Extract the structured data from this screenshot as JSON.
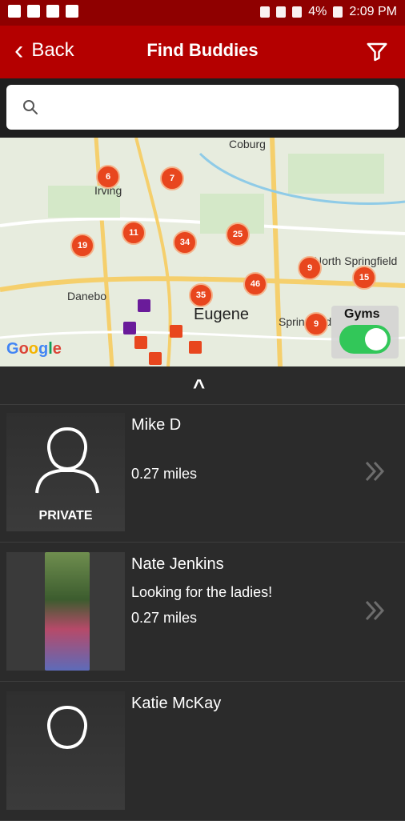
{
  "status": {
    "time": "2:09 PM",
    "battery_text": "4%"
  },
  "header": {
    "back_label": "Back",
    "title": "Find Buddies"
  },
  "search": {
    "placeholder": ""
  },
  "map": {
    "labels": [
      "Coburg",
      "Irving",
      "Danebo",
      "Eugene",
      "Springfield",
      "North Springfield"
    ],
    "clusters": [
      "6",
      "7",
      "19",
      "11",
      "34",
      "25",
      "35",
      "46",
      "9",
      "15",
      "9"
    ],
    "google_logo": "Google",
    "gyms_label": "Gyms",
    "gyms_enabled": true
  },
  "list": {
    "rows": [
      {
        "name": "Mike D",
        "tagline": "",
        "distance": "0.27 miles",
        "private": true,
        "private_label": "PRIVATE"
      },
      {
        "name": "Nate Jenkins",
        "tagline": "Looking for the ladies!",
        "distance": "0.27 miles",
        "private": false
      },
      {
        "name": "Katie McKay",
        "tagline": "",
        "distance": "",
        "private": true,
        "private_label": ""
      }
    ]
  },
  "colors": {
    "brand": "#b40000",
    "status": "#8f0000",
    "panel": "#2b2b2b",
    "accent": "#e8461e",
    "toggle_on": "#32c759"
  }
}
